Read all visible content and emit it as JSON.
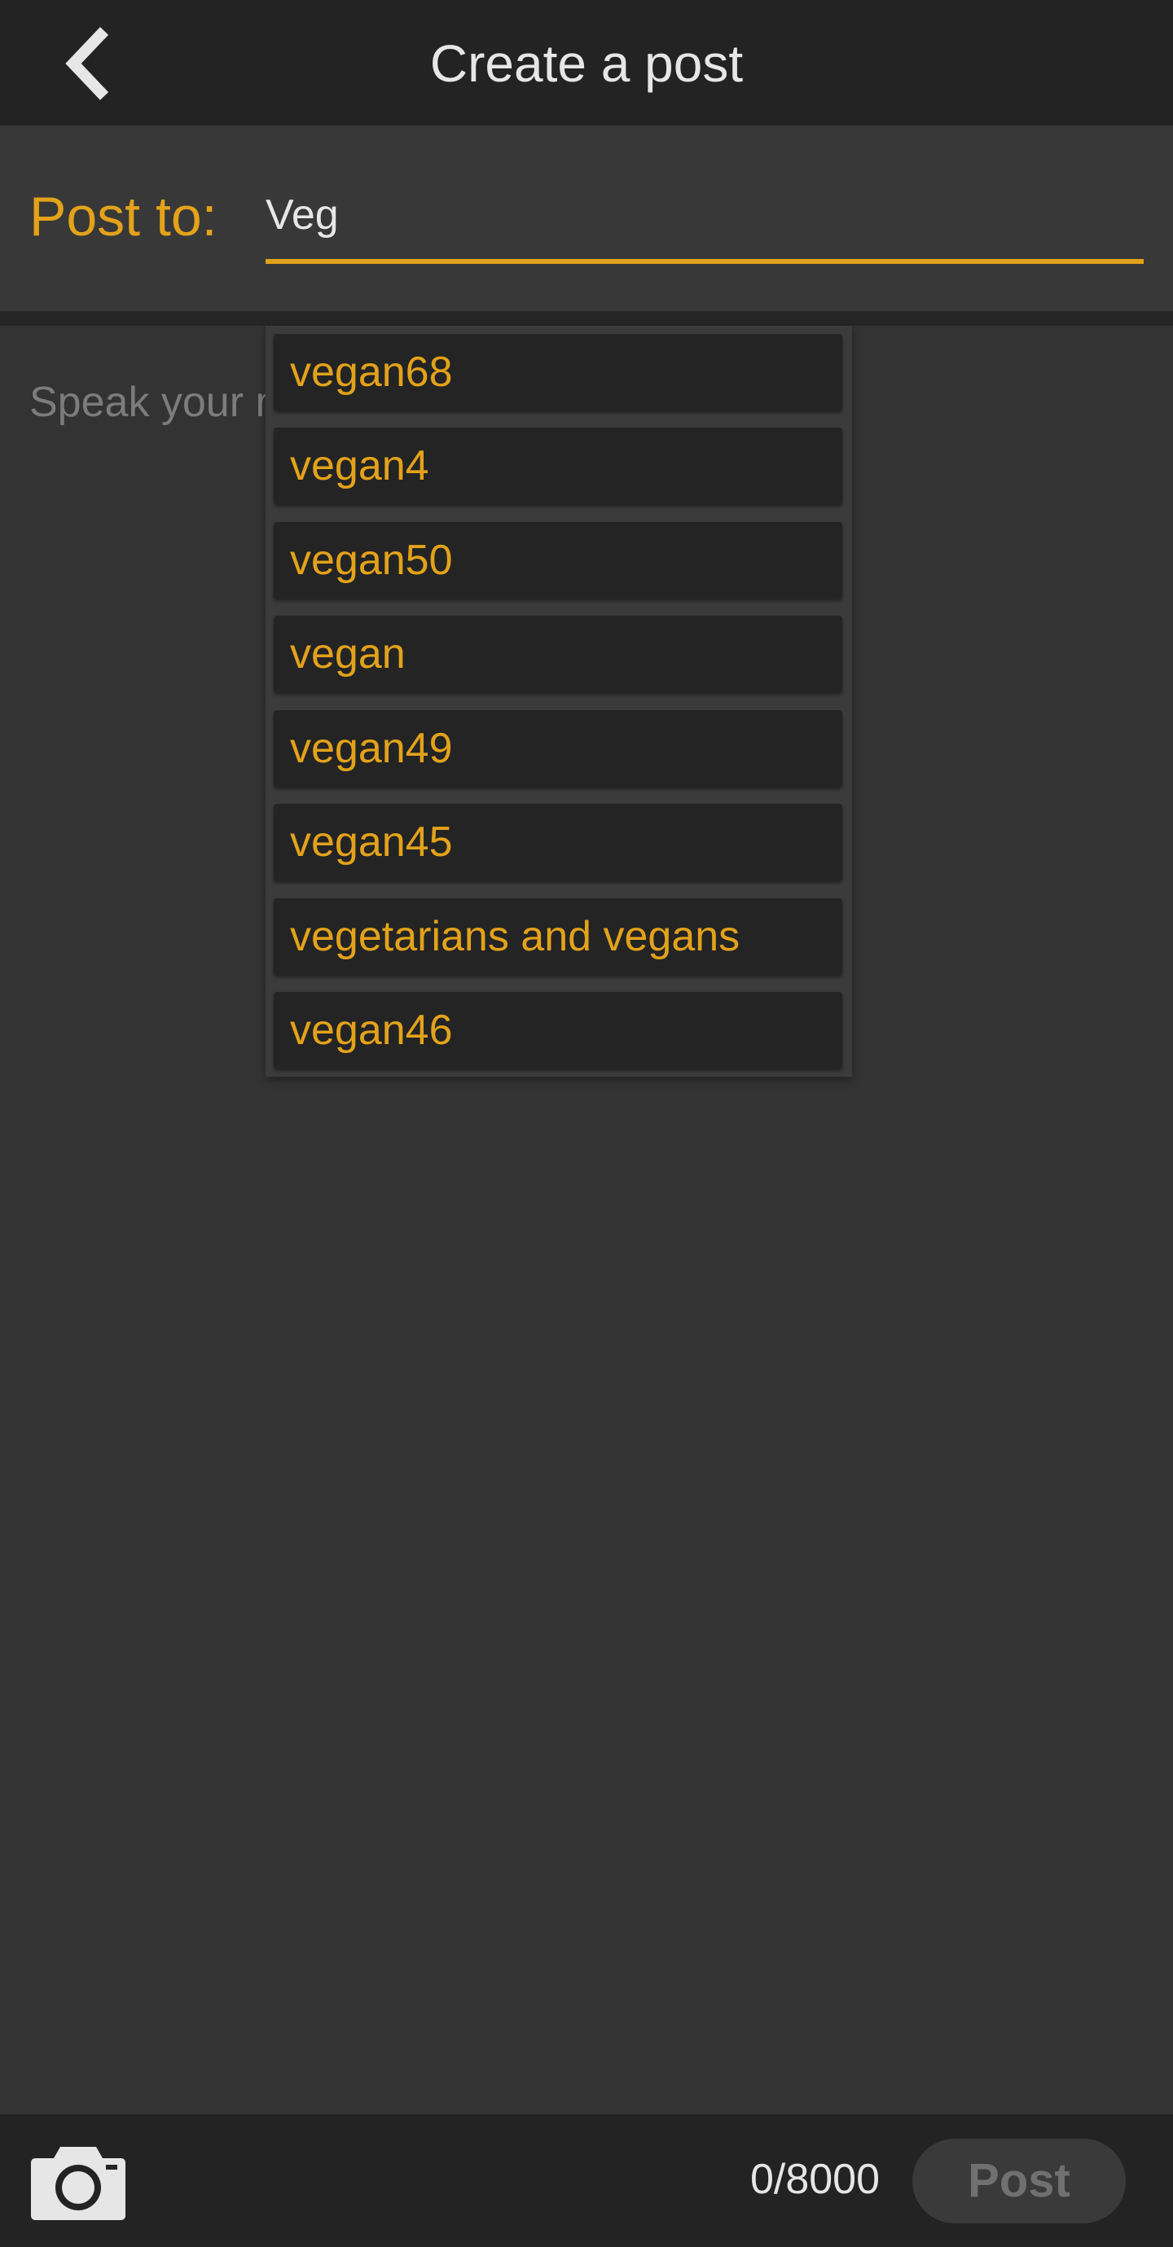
{
  "header": {
    "title": "Create a post",
    "back_icon": "chevron-left-icon"
  },
  "post_to": {
    "label": "Post to:",
    "value": "Veg"
  },
  "body": {
    "placeholder": "Speak your m"
  },
  "suggestions": [
    "vegan68",
    "vegan4",
    "vegan50",
    "vegan",
    "vegan49",
    "vegan45",
    "vegetarians and vegans",
    "vegan46"
  ],
  "footer": {
    "camera_icon": "camera-icon",
    "char_count": "0/8000",
    "post_label": "Post"
  },
  "colors": {
    "accent": "#e3a21a",
    "background": "#333333",
    "bar": "#232323"
  }
}
